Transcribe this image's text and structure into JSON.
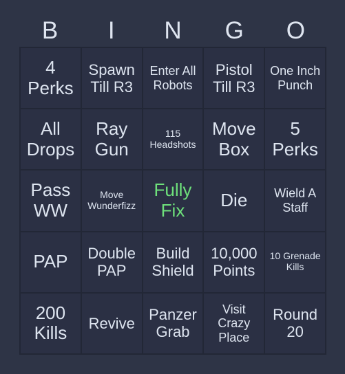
{
  "card": {
    "header_letters": [
      "B",
      "I",
      "N",
      "G",
      "O"
    ],
    "free_space_color": "#6ee07b",
    "text_color": "#dde4ef",
    "cell_background": "#2b3044",
    "page_background": "#2e3446",
    "grid_line_color": "#222736",
    "rows": [
      [
        {
          "text": "4 Perks",
          "size": "lg",
          "marked": false
        },
        {
          "text": "Spawn Till R3",
          "size": "md",
          "marked": false
        },
        {
          "text": "Enter All Robots",
          "size": "sm",
          "marked": false
        },
        {
          "text": "Pistol Till R3",
          "size": "md",
          "marked": false
        },
        {
          "text": "One Inch Punch",
          "size": "sm",
          "marked": false
        }
      ],
      [
        {
          "text": "All Drops",
          "size": "lg",
          "marked": false
        },
        {
          "text": "Ray Gun",
          "size": "lg",
          "marked": false
        },
        {
          "text": "115 Headshots",
          "size": "xs",
          "marked": false
        },
        {
          "text": "Move Box",
          "size": "lg",
          "marked": false
        },
        {
          "text": "5 Perks",
          "size": "lg",
          "marked": false
        }
      ],
      [
        {
          "text": "Pass WW",
          "size": "lg",
          "marked": false
        },
        {
          "text": "Move Wunderfizz",
          "size": "xs",
          "marked": false
        },
        {
          "text": "Fully Fix",
          "size": "lg",
          "marked": true
        },
        {
          "text": "Die",
          "size": "lg",
          "marked": false
        },
        {
          "text": "Wield A Staff",
          "size": "sm",
          "marked": false
        }
      ],
      [
        {
          "text": "PAP",
          "size": "lg",
          "marked": false
        },
        {
          "text": "Double PAP",
          "size": "md",
          "marked": false
        },
        {
          "text": "Build Shield",
          "size": "md",
          "marked": false
        },
        {
          "text": "10,000 Points",
          "size": "md",
          "marked": false
        },
        {
          "text": "10 Grenade Kills",
          "size": "xs",
          "marked": false
        }
      ],
      [
        {
          "text": "200 Kills",
          "size": "lg",
          "marked": false
        },
        {
          "text": "Revive",
          "size": "md",
          "marked": false
        },
        {
          "text": "Panzer Grab",
          "size": "md",
          "marked": false
        },
        {
          "text": "Visit Crazy Place",
          "size": "sm",
          "marked": false
        },
        {
          "text": "Round 20",
          "size": "md",
          "marked": false
        }
      ]
    ]
  }
}
